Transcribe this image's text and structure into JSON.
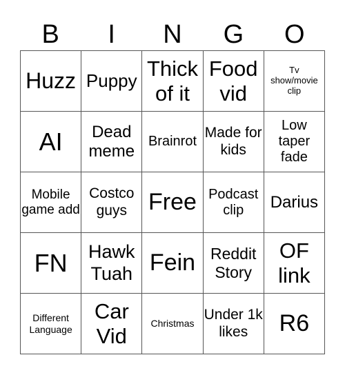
{
  "header": [
    "B",
    "I",
    "N",
    "G",
    "O"
  ],
  "cells": [
    {
      "text": "Huzz",
      "size": 32
    },
    {
      "text": "Puppy",
      "size": 26
    },
    {
      "text": "Thick of it",
      "size": 31
    },
    {
      "text": "Food vid",
      "size": 31
    },
    {
      "text": "Tv show/movie clip",
      "size": 13
    },
    {
      "text": "AI",
      "size": 36
    },
    {
      "text": "Dead meme",
      "size": 24
    },
    {
      "text": "Brainrot",
      "size": 20
    },
    {
      "text": "Made for kids",
      "size": 21
    },
    {
      "text": "Low taper fade",
      "size": 20
    },
    {
      "text": "Mobile game add",
      "size": 19
    },
    {
      "text": "Costco guys",
      "size": 21
    },
    {
      "text": "Free",
      "size": 34
    },
    {
      "text": "Podcast clip",
      "size": 20
    },
    {
      "text": "Darius",
      "size": 24
    },
    {
      "text": "FN",
      "size": 36
    },
    {
      "text": "Hawk Tuah",
      "size": 27
    },
    {
      "text": "Fein",
      "size": 34
    },
    {
      "text": "Reddit Story",
      "size": 23
    },
    {
      "text": "OF link",
      "size": 31
    },
    {
      "text": "Different Language",
      "size": 14
    },
    {
      "text": "Car Vid",
      "size": 31
    },
    {
      "text": "Christmas",
      "size": 14
    },
    {
      "text": "Under 1k likes",
      "size": 21
    },
    {
      "text": "R6",
      "size": 34
    }
  ]
}
